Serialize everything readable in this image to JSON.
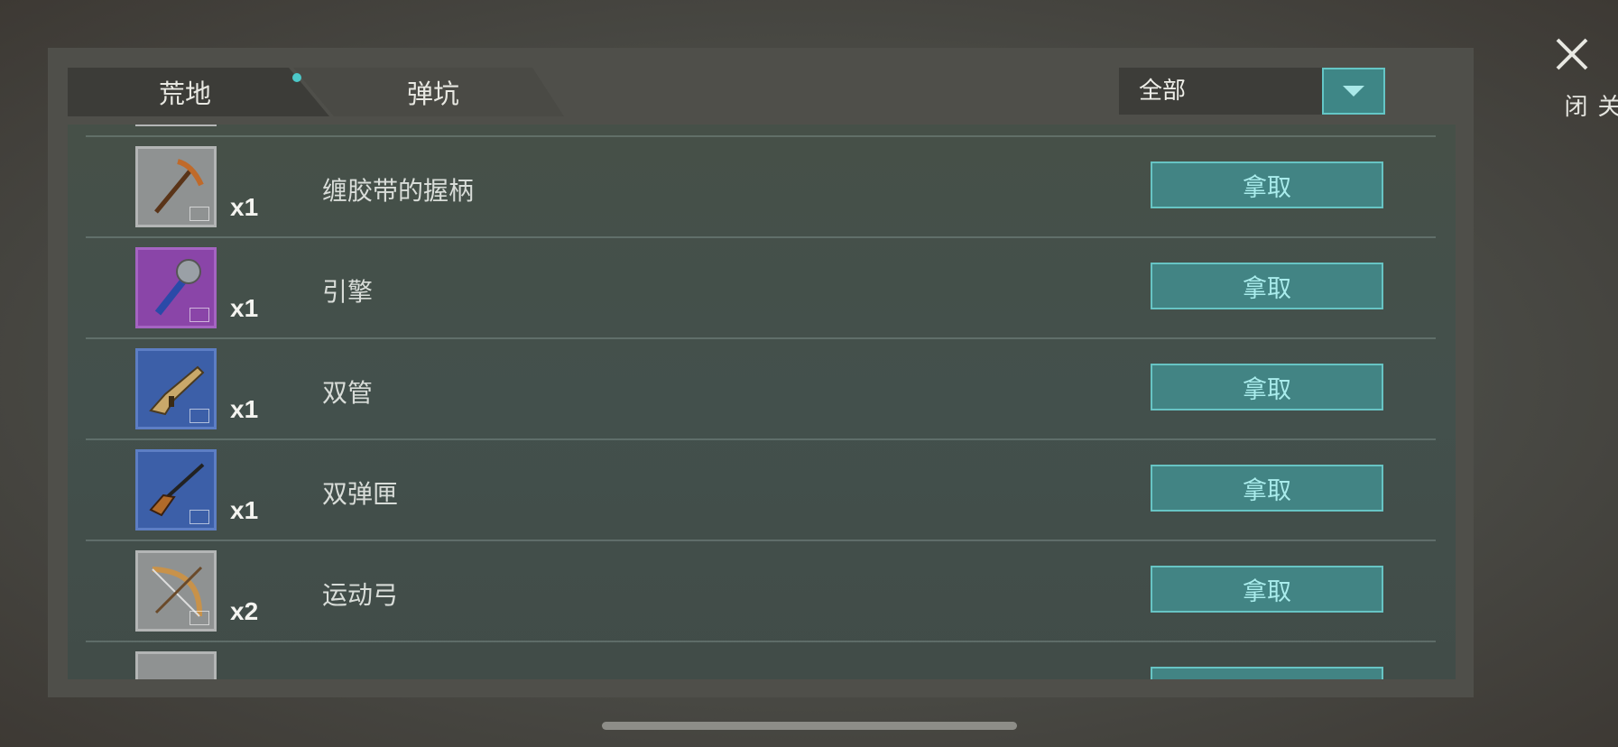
{
  "tabs": [
    {
      "label": "荒地",
      "active": true,
      "has_notification_dot": true
    },
    {
      "label": "弹坑",
      "active": false
    }
  ],
  "filter": {
    "selected": "全部"
  },
  "items": [
    {
      "name": "缠胶带的握柄",
      "quantity": "x1",
      "icon": "pickaxe-icon",
      "rarity": "gray",
      "action": "拿取"
    },
    {
      "name": "引擎",
      "quantity": "x1",
      "icon": "mace-icon",
      "rarity": "purple",
      "action": "拿取"
    },
    {
      "name": "双管",
      "quantity": "x1",
      "icon": "assault-rifle-icon",
      "rarity": "blue",
      "action": "拿取"
    },
    {
      "name": "双弹匣",
      "quantity": "x1",
      "icon": "sniper-rifle-icon",
      "rarity": "blue",
      "action": "拿取"
    },
    {
      "name": "运动弓",
      "quantity": "x2",
      "icon": "bow-icon",
      "rarity": "gray",
      "action": "拿取"
    }
  ],
  "close": {
    "label": "关闭"
  },
  "colors": {
    "accent": "#428484",
    "accent_border": "#67c4c4",
    "button_text": "#a9ecec"
  }
}
